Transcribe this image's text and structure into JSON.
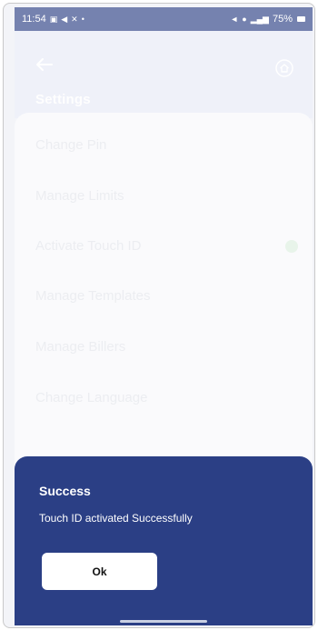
{
  "status_bar": {
    "time": "11:54",
    "left_icons": [
      "notification-icon",
      "send-icon",
      "x-icon"
    ],
    "battery_percent": "75%"
  },
  "header": {
    "title": "Settings"
  },
  "settings_menu": {
    "items": [
      {
        "label": "Change Pin"
      },
      {
        "label": "Manage Limits"
      },
      {
        "label": "Activate Touch ID"
      },
      {
        "label": "Manage Templates"
      },
      {
        "label": "Manage Billers"
      },
      {
        "label": "Change Language"
      }
    ],
    "touch_id_enabled": true
  },
  "dialog": {
    "title": "Success",
    "message": "Touch ID activated Successfully",
    "ok_label": "Ok"
  },
  "colors": {
    "primary": "#2b3f85",
    "sheet_text": "#ffffff",
    "button_bg": "#ffffff"
  }
}
